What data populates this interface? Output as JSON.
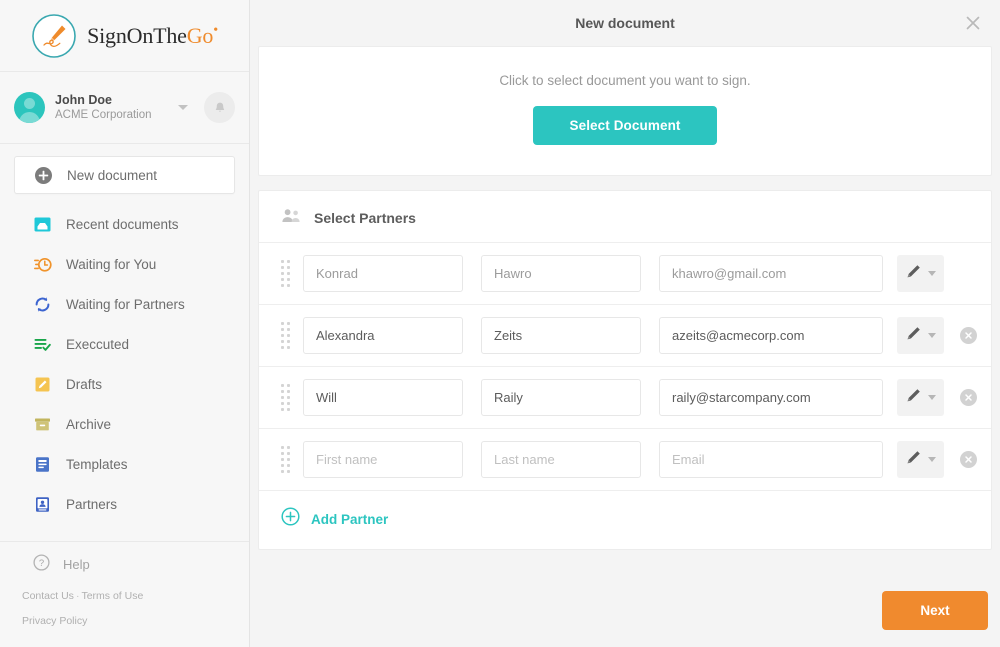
{
  "brand": {
    "name_part1": "SignOnThe",
    "name_part2": "Go",
    "trademark": "•",
    "logo_icon": "pen-signature-logo-icon",
    "accent_teal": "#2cc5c0",
    "accent_orange": "#f08a2e"
  },
  "user": {
    "name": "John Doe",
    "organization": "ACME Corporation",
    "avatar_icon": "avatar-icon",
    "dropdown_icon": "chevron-down-icon",
    "notifications_icon": "bell-icon"
  },
  "sidebar": {
    "items": [
      {
        "label": "New document",
        "icon": "plus-circle-icon",
        "active": true
      },
      {
        "label": "Recent documents",
        "icon": "inbox-icon",
        "active": false
      },
      {
        "label": "Waiting for You",
        "icon": "clock-pending-icon",
        "active": false
      },
      {
        "label": "Waiting for Partners",
        "icon": "refresh-cycle-icon",
        "active": false
      },
      {
        "label": "Execcuted",
        "icon": "list-check-icon",
        "active": false
      },
      {
        "label": "Drafts",
        "icon": "pencil-square-icon",
        "active": false
      },
      {
        "label": "Archive",
        "icon": "archive-box-icon",
        "active": false
      },
      {
        "label": "Templates",
        "icon": "document-lines-icon",
        "active": false
      },
      {
        "label": "Partners",
        "icon": "contact-card-icon",
        "active": false
      }
    ],
    "help": {
      "label": "Help",
      "icon": "question-circle-icon"
    },
    "legal": {
      "contact": "Contact Us",
      "separator": "·",
      "terms": "Terms of Use",
      "privacy": "Privacy Policy"
    }
  },
  "topbar": {
    "title": "New document",
    "close_icon": "close-icon"
  },
  "document_section": {
    "hint": "Click to select document you want to sign.",
    "select_button": "Select Document"
  },
  "partners_section": {
    "title": "Select Partners",
    "title_icon": "group-people-icon",
    "drag_handle_icon": "drag-dots-icon",
    "sign_action_icon": "pen-icon",
    "action_caret_icon": "chevron-down-icon",
    "remove_icon": "remove-circle-icon",
    "placeholders": {
      "first": "First name",
      "last": "Last name",
      "email": "Email"
    },
    "rows": [
      {
        "first": "Konrad",
        "last": "Hawro",
        "email": "khawro@gmail.com",
        "removable": false,
        "muted": true
      },
      {
        "first": "Alexandra",
        "last": "Zeits",
        "email": "azeits@acmecorp.com",
        "removable": true,
        "muted": false
      },
      {
        "first": "Will",
        "last": "Raily",
        "email": "raily@starcompany.com",
        "removable": true,
        "muted": false
      },
      {
        "first": "",
        "last": "",
        "email": "",
        "removable": true,
        "muted": false
      }
    ],
    "add_partner": {
      "label": "Add Partner",
      "icon": "plus-circle-outline-icon"
    }
  },
  "footer": {
    "next_button": "Next"
  }
}
